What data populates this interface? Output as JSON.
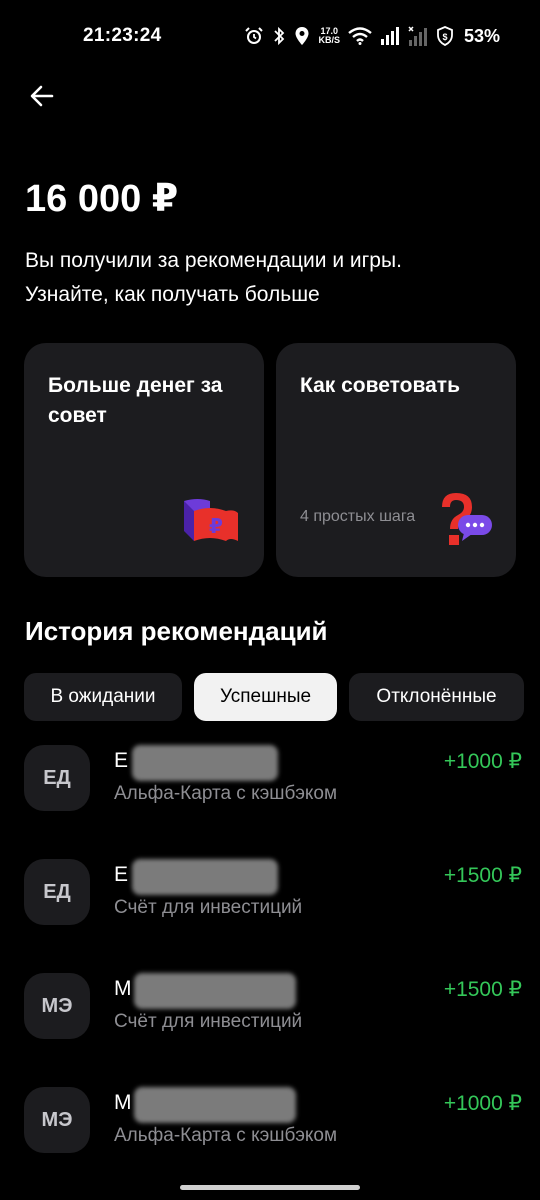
{
  "status_bar": {
    "time": "21:23:24",
    "net_speed_value": "17.0",
    "net_speed_unit": "KB/S",
    "battery": "53%",
    "icons": [
      "alarm-icon",
      "bluetooth-icon",
      "location-icon",
      "wifi-icon",
      "signal-icon",
      "signal-no-service-icon",
      "shield-dollar-icon"
    ]
  },
  "header": {
    "back_icon": "arrow-left-icon"
  },
  "summary": {
    "amount": "16 000 ₽",
    "line1": "Вы получили за рекомендации и игры.",
    "line2": "Узнайте, как получать больше"
  },
  "cards": [
    {
      "title": "Больше денег за совет",
      "subtitle": "",
      "icon": "ruble-flag-icon"
    },
    {
      "title": "Как советовать",
      "subtitle": "4 простых шага",
      "icon": "question-chat-icon"
    }
  ],
  "history": {
    "title": "История рекомендаций",
    "tabs": [
      {
        "label": "В ожидании",
        "active": false
      },
      {
        "label": "Успешные",
        "active": true
      },
      {
        "label": "Отклонённые",
        "active": false
      }
    ],
    "items": [
      {
        "initials": "ЕД",
        "name_visible": "Е",
        "product": "Альфа-Карта с кэшбэком",
        "reward": "+1000 ₽"
      },
      {
        "initials": "ЕД",
        "name_visible": "Е",
        "product": "Счёт для инвестиций",
        "reward": "+1500 ₽"
      },
      {
        "initials": "МЭ",
        "name_visible": "М",
        "product": "Счёт для инвестиций",
        "reward": "+1500 ₽"
      },
      {
        "initials": "МЭ",
        "name_visible": "М",
        "product": "Альфа-Карта с кэшбэком",
        "reward": "+1000 ₽"
      }
    ]
  },
  "colors": {
    "background": "#000000",
    "card": "#1c1c1f",
    "reward_green": "#34c759",
    "secondary_text": "#8e8e93",
    "active_tab": "#f2f2f2"
  }
}
